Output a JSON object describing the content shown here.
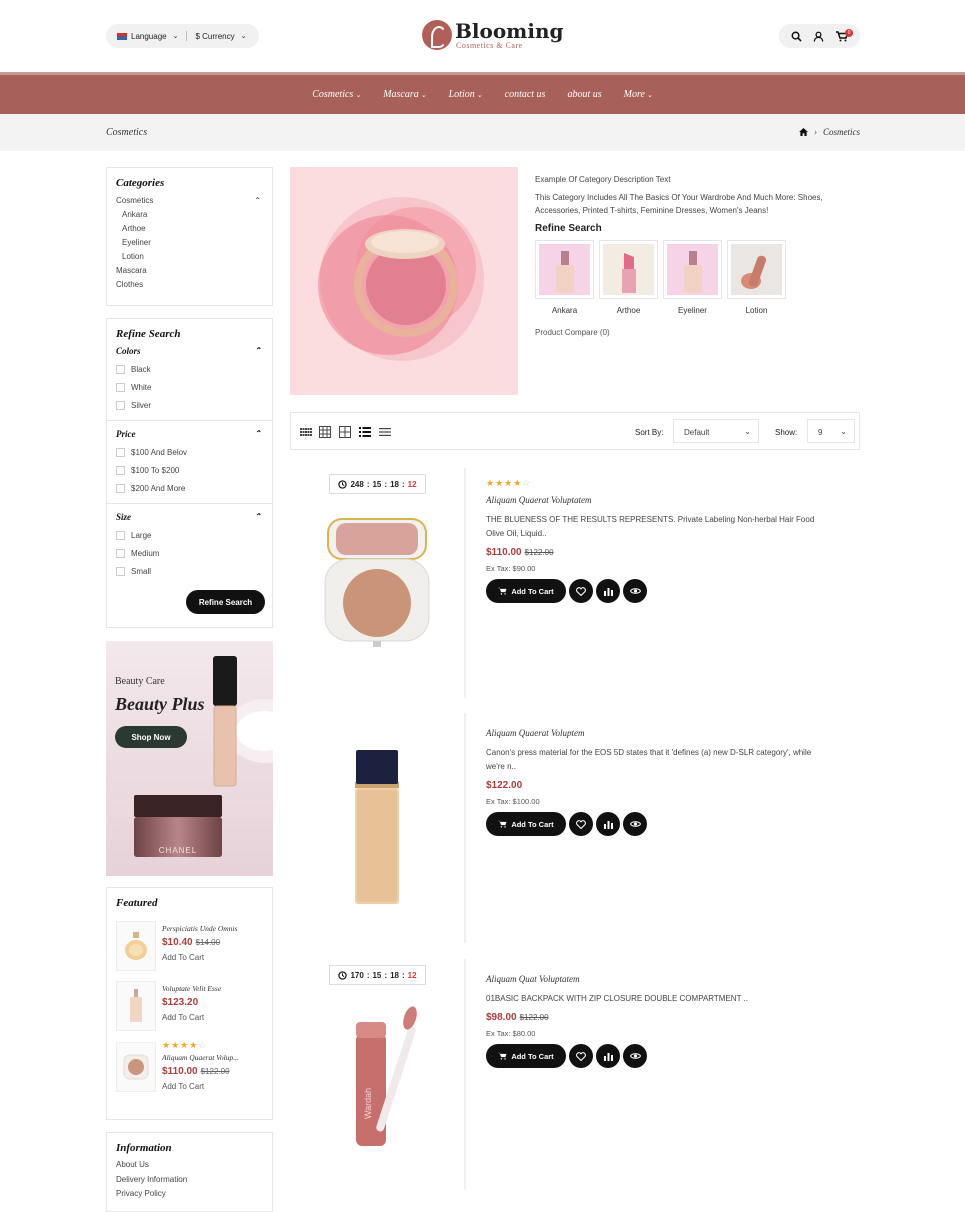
{
  "header": {
    "language": "Language",
    "currency": "$ Currency",
    "logo_name": "Blooming",
    "logo_tagline": "Cosmetics & Care",
    "cart_count": "0"
  },
  "nav": [
    "Cosmetics",
    "Mascara",
    "Lotion",
    "contact us",
    "about us",
    "More"
  ],
  "breadcrumb": {
    "title": "Cosmetics",
    "current": "Cosmetics"
  },
  "sidebar": {
    "categories_title": "Categories",
    "categories": [
      {
        "label": "Cosmetics",
        "toggle": "⌃"
      },
      {
        "label": "Ankara"
      },
      {
        "label": "Arthoe"
      },
      {
        "label": "Eyeliner"
      },
      {
        "label": "Lotion"
      },
      {
        "label": "Mascara"
      },
      {
        "label": "Clothes"
      }
    ],
    "refine_title": "Refine Search",
    "colors_title": "Colors",
    "colors": [
      "Black",
      "White",
      "Silver"
    ],
    "price_title": "Price",
    "prices": [
      "$100 And Belov",
      "$100 To $200",
      "$200 And More"
    ],
    "size_title": "Size",
    "sizes": [
      "Large",
      "Medium",
      "Small"
    ],
    "refine_button": "Refine Search"
  },
  "banner": {
    "subtitle": "Beauty Care",
    "title": "Beauty Plus",
    "button": "Shop Now",
    "jar_brand": "CHANEL"
  },
  "featured": {
    "title": "Featured",
    "items": [
      {
        "name": "Perspiciatis Unde Omnis",
        "price": "$10.40",
        "old_price": "$14.00",
        "cart": "Add To Cart"
      },
      {
        "name": "Voluptate Velit Esse",
        "price": "$123.20",
        "old_price": "",
        "cart": "Add To Cart"
      },
      {
        "name": "Aliquam Quaerat Volup...",
        "price": "$110.00",
        "old_price": "$122.00",
        "cart": "Add To Cart",
        "rating": 4
      }
    ]
  },
  "information": {
    "title": "Information",
    "links": [
      "About Us",
      "Delivery Information",
      "Privacy Policy"
    ]
  },
  "category": {
    "desc_title": "Example Of Category Description Text",
    "desc_body": "This Category Includes All The Basics Of Your Wardrobe And Much More: Shoes, Accessories, Printed T-shirts, Feminine Dresses, Women's Jeans!",
    "refine_title": "Refine Search",
    "subcats": [
      "Ankara",
      "Arthoe",
      "Eyeliner",
      "Lotion"
    ],
    "compare": "Product Compare (0)"
  },
  "toolbar": {
    "sort_label": "Sort By:",
    "sort_value": "Default",
    "show_label": "Show:",
    "show_value": "9"
  },
  "products": [
    {
      "timer": {
        "d": "248",
        "h": "15",
        "m": "18",
        "s": "12"
      },
      "rating": 4,
      "name": "Aliquam Quaerat Voluptatem",
      "desc": "THE BLUENESS OF THE RESULTS REPRESENTS. Private Labeling Non-herbal Hair Food Olive Oil, Liquid..",
      "price": "$110.00",
      "old_price": "$122.00",
      "tax": "Ex Tax: $90.00",
      "cart": "Add To Cart"
    },
    {
      "name": "Aliquam Quaerat Voluptem",
      "desc": "Canon's press material for the EOS 5D states that it 'defines (a) new D-SLR category', while we're n..",
      "price": "$122.00",
      "old_price": "",
      "tax": "Ex Tax: $100.00",
      "cart": "Add To Cart"
    },
    {
      "timer": {
        "d": "170",
        "h": "15",
        "m": "18",
        "s": "12"
      },
      "name": "Aliquam Quat Voluptatem",
      "desc": "01BASIC BACKPACK WITH ZIP CLOSURE DOUBLE COMPARTMENT ..",
      "price": "$98.00",
      "old_price": "$122.00",
      "tax": "Ex Tax: $80.00",
      "cart": "Add To Cart",
      "brand": "Wardah"
    }
  ],
  "colors": {
    "brand": "#a8605a",
    "price": "#a8403a",
    "star": "#f5a623"
  }
}
